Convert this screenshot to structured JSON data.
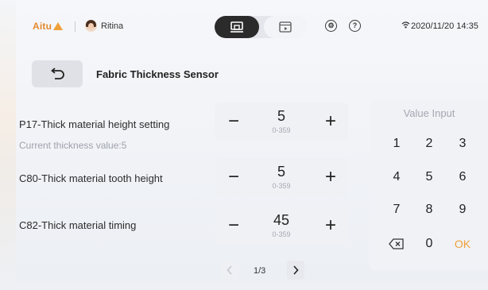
{
  "status": {
    "brand": "Aitu",
    "user_name": "Ritina",
    "datetime": "2020/11/20 14:35"
  },
  "header": {
    "title": "Fabric Thickness Sensor"
  },
  "settings": [
    {
      "label": "P17-Thick material height setting",
      "value": "5",
      "range": "0-359"
    },
    {
      "label": "C80-Thick material tooth height",
      "value": "5",
      "range": "0-359"
    },
    {
      "label": "C82-Thick material timing",
      "value": "45",
      "range": "0-359"
    }
  ],
  "current_thickness": "Current thickness value:5",
  "stepper": {
    "minus": "−",
    "plus": "+"
  },
  "pagination": {
    "current": "1/3"
  },
  "keypad": {
    "title": "Value Input",
    "keys": [
      "1",
      "2",
      "3",
      "4",
      "5",
      "6",
      "7",
      "8",
      "9",
      "0",
      "OK"
    ]
  },
  "colors": {
    "accent": "#f0a03a",
    "active_mode": "#2b2b2b"
  },
  "icons": [
    "back-arrow-icon",
    "machine-mode-icon",
    "video-mode-icon",
    "gear-icon",
    "help-icon",
    "wifi-icon",
    "backspace-icon",
    "chevron-left-icon",
    "chevron-right-icon"
  ]
}
